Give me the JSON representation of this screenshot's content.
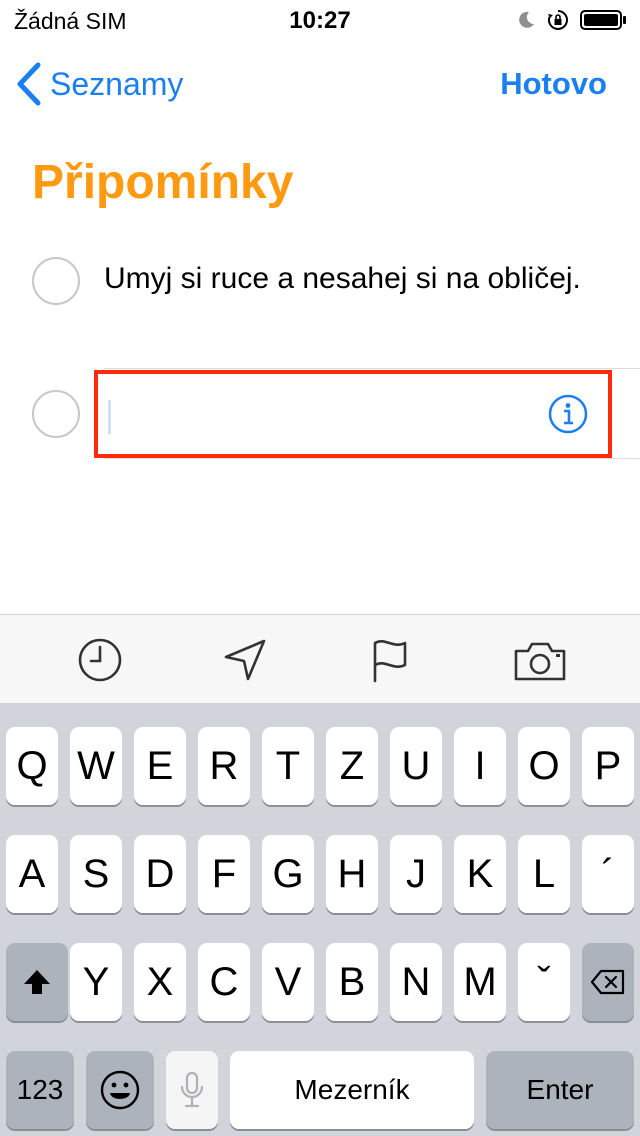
{
  "status_bar": {
    "carrier": "Žádná SIM",
    "time": "10:27"
  },
  "nav": {
    "back_label": "Seznamy",
    "done_label": "Hotovo"
  },
  "list": {
    "title": "Připomínky",
    "title_color": "#fd9a0f"
  },
  "reminders": [
    {
      "text": "Umyj si ruce a nesahej si na obličej."
    }
  ],
  "new_reminder": {
    "value": ""
  },
  "toolbar": {
    "icons": [
      "clock-icon",
      "location-arrow-icon",
      "flag-icon",
      "camera-icon"
    ]
  },
  "keyboard": {
    "row1": [
      "Q",
      "W",
      "E",
      "R",
      "T",
      "Z",
      "U",
      "I",
      "O",
      "P"
    ],
    "row2": [
      "A",
      "S",
      "D",
      "F",
      "G",
      "H",
      "J",
      "K",
      "L",
      "´"
    ],
    "row3": [
      "Y",
      "X",
      "C",
      "V",
      "B",
      "N",
      "M",
      "ˇ"
    ],
    "numbers_label": "123",
    "space_label": "Mezerník",
    "enter_label": "Enter"
  },
  "colors": {
    "accent": "#1a7ff0",
    "highlight_border": "#ff2a0a"
  }
}
